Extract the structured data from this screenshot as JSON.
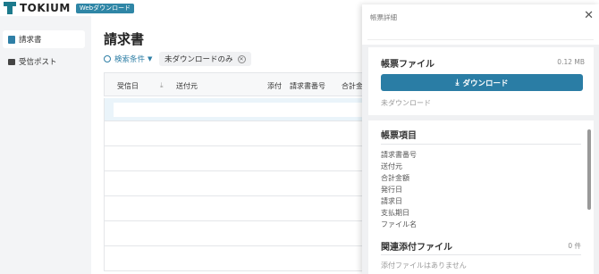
{
  "app": {
    "logo_text": "TOKIUM",
    "badge": "Webダウンロード"
  },
  "sidebar": {
    "items": [
      {
        "label": "請求書",
        "icon": "document-icon",
        "active": true
      },
      {
        "label": "受信ポスト",
        "icon": "folder-icon",
        "active": false
      }
    ]
  },
  "main": {
    "title": "請求書",
    "filter_label": "検索条件",
    "chip_label": "未ダウンロードのみ",
    "columns": [
      "受信日",
      "送付元",
      "添付",
      "請求書番号",
      "合計金"
    ]
  },
  "panel": {
    "title": "帳票詳細",
    "file_section": {
      "title": "帳票ファイル",
      "size": "0.12 MB",
      "download_label": "ダウンロード",
      "status": "未ダウンロード"
    },
    "items_section": {
      "title": "帳票項目",
      "fields": [
        "請求書番号",
        "送付元",
        "合計金額",
        "発行日",
        "請求日",
        "支払期日",
        "ファイル名"
      ]
    },
    "attachments_section": {
      "title": "関連添付ファイル",
      "count": "0 件",
      "empty": "添付ファイルはありません"
    }
  },
  "colors": {
    "accent": "#2a7da5",
    "brand": "#1d7a8c"
  }
}
